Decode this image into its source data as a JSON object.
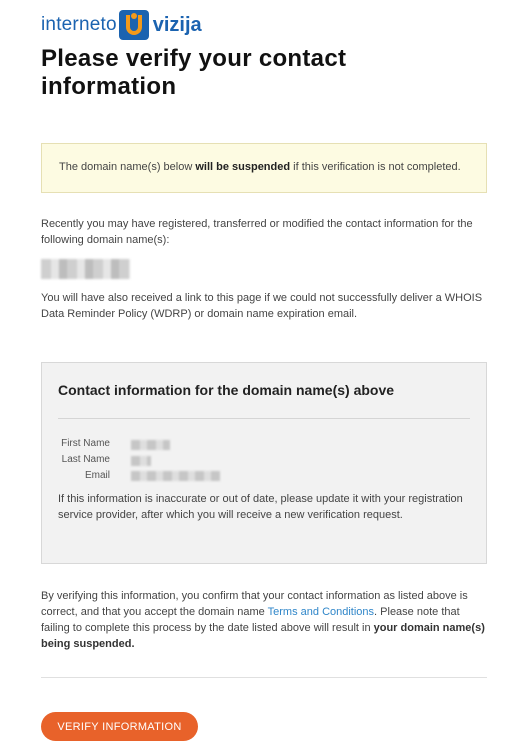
{
  "brand": {
    "word1": "interneto",
    "word2": "vizija",
    "colors": {
      "blue": "#1b63b0",
      "orange": "#f39a1b"
    }
  },
  "title": "Please verify your contact information",
  "notice": {
    "before": "The domain name(s) below ",
    "bold": "will be suspended",
    "after": " if this verification is not completed."
  },
  "intro": "Recently you may have registered, transferred or modified the contact information for the following domain name(s):",
  "received_note": "You will have also received a link to this page if we could not successfully deliver a WHOIS Data Reminder Policy (WDRP) or domain name expiration email.",
  "contact": {
    "heading": "Contact information for the domain name(s) above",
    "labels": {
      "first_name": "First Name",
      "last_name": "Last Name",
      "email": "Email"
    },
    "note": "If this information is inaccurate or out of date, please update it with your registration service provider, after which you will receive a new verification request."
  },
  "terms": {
    "part1": "By verifying this information, you confirm that your contact information as listed above is correct, and that you accept the domain name ",
    "link": "Terms and Conditions",
    "part2": ". Please note that failing to complete this process by the date listed above will result in ",
    "bold": "your domain name(s) being suspended."
  },
  "button": {
    "label": "VERIFY INFORMATION",
    "color": "#e8622a"
  }
}
